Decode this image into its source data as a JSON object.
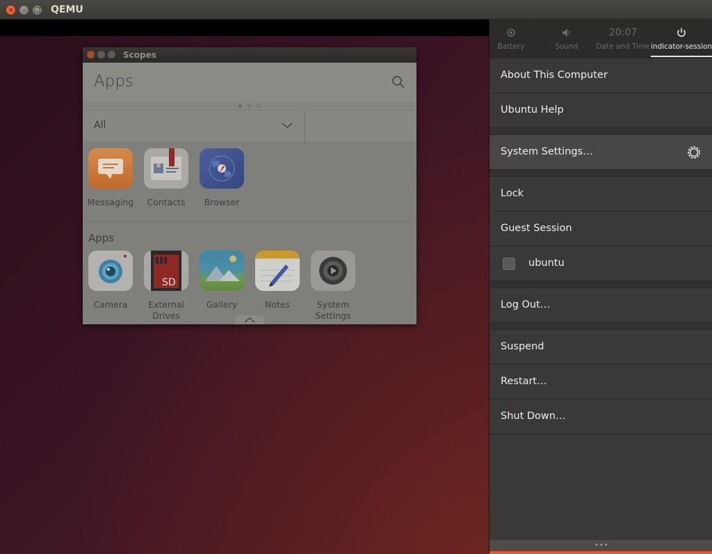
{
  "host_window": {
    "title": "QEMU",
    "close_glyph": "×",
    "min_glyph": "–",
    "max_glyph": "□"
  },
  "scopes_window": {
    "title": "Scopes",
    "header_title": "Apps",
    "filter_label": "All",
    "top_apps": [
      {
        "label": "Messaging",
        "icon": "messaging-icon"
      },
      {
        "label": "Contacts",
        "icon": "contacts-icon"
      },
      {
        "label": "Browser",
        "icon": "browser-icon"
      }
    ],
    "section_title": "Apps",
    "apps": [
      {
        "label_line1": "Camera",
        "label_line2": "",
        "icon": "camera-icon"
      },
      {
        "label_line1": "External",
        "label_line2": "Drives",
        "icon": "sd-card-icon",
        "icon_text": "SD"
      },
      {
        "label_line1": "Gallery",
        "label_line2": "",
        "icon": "gallery-icon"
      },
      {
        "label_line1": "Notes",
        "label_line2": "",
        "icon": "notes-icon"
      },
      {
        "label_line1": "System",
        "label_line2": "Settings",
        "icon": "system-settings-icon"
      }
    ]
  },
  "indicator_panel": {
    "tabs": [
      {
        "label": "Battery",
        "icon": "battery-icon"
      },
      {
        "label": "Sound",
        "icon": "sound-icon"
      },
      {
        "label": "Date and Time",
        "time": "20:07"
      },
      {
        "label": "indicator-session",
        "icon": "power-icon",
        "active": true
      }
    ],
    "items": {
      "about": "About This Computer",
      "help": "Ubuntu Help",
      "settings": "System Settings…",
      "lock": "Lock",
      "guest": "Guest Session",
      "user": "ubuntu",
      "logout": "Log Out…",
      "suspend": "Suspend",
      "restart": "Restart…",
      "shutdown": "Shut Down…"
    },
    "handle_dots": "•••"
  }
}
